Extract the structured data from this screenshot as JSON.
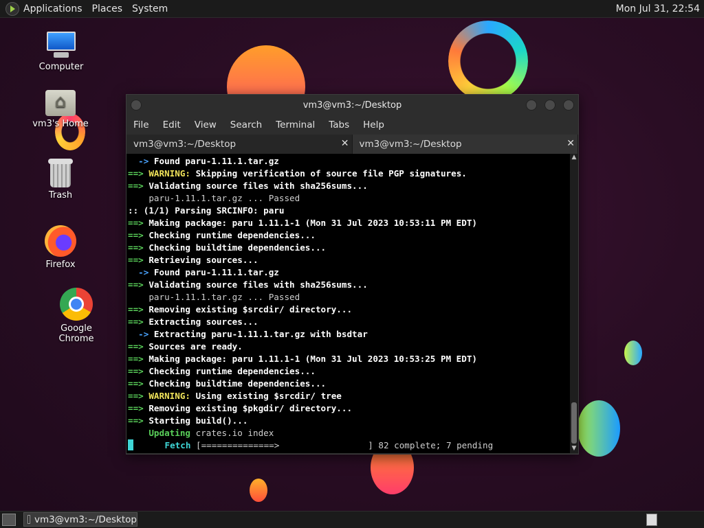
{
  "top_panel": {
    "menus": [
      "Applications",
      "Places",
      "System"
    ],
    "clock": "Mon Jul 31, 22:54"
  },
  "desktop_icons": [
    {
      "label": "Computer"
    },
    {
      "label": "vm3's Home"
    },
    {
      "label": "Trash"
    },
    {
      "label": "Firefox"
    },
    {
      "label": "Google Chrome"
    }
  ],
  "window": {
    "title": "vm3@vm3:~/Desktop",
    "menu": [
      "File",
      "Edit",
      "View",
      "Search",
      "Terminal",
      "Tabs",
      "Help"
    ],
    "tabs": [
      {
        "label": "vm3@vm3:~/Desktop",
        "close": "✕"
      },
      {
        "label": "vm3@vm3:~/Desktop",
        "close": "✕"
      }
    ]
  },
  "terminal": {
    "lines": [
      [
        {
          "c": "bl",
          "t": "  -> "
        },
        {
          "c": "w",
          "t": "Found paru-1.11.1.tar.gz"
        }
      ],
      [
        {
          "c": "g",
          "t": "==> "
        },
        {
          "c": "y",
          "t": "WARNING: "
        },
        {
          "c": "w",
          "t": "Skipping verification of source file PGP signatures."
        }
      ],
      [
        {
          "c": "g",
          "t": "==> "
        },
        {
          "c": "w",
          "t": "Validating source files with sha256sums..."
        }
      ],
      [
        {
          "c": "d",
          "t": "    paru-1.11.1.tar.gz ... Passed"
        }
      ],
      [
        {
          "c": "w",
          "t": ":: (1/1) Parsing SRCINFO: paru"
        }
      ],
      [
        {
          "c": "g",
          "t": "==> "
        },
        {
          "c": "w",
          "t": "Making package: paru 1.11.1-1 (Mon 31 Jul 2023 10:53:11 PM EDT)"
        }
      ],
      [
        {
          "c": "g",
          "t": "==> "
        },
        {
          "c": "w",
          "t": "Checking runtime dependencies..."
        }
      ],
      [
        {
          "c": "g",
          "t": "==> "
        },
        {
          "c": "w",
          "t": "Checking buildtime dependencies..."
        }
      ],
      [
        {
          "c": "g",
          "t": "==> "
        },
        {
          "c": "w",
          "t": "Retrieving sources..."
        }
      ],
      [
        {
          "c": "bl",
          "t": "  -> "
        },
        {
          "c": "w",
          "t": "Found paru-1.11.1.tar.gz"
        }
      ],
      [
        {
          "c": "g",
          "t": "==> "
        },
        {
          "c": "w",
          "t": "Validating source files with sha256sums..."
        }
      ],
      [
        {
          "c": "d",
          "t": "    paru-1.11.1.tar.gz ... Passed"
        }
      ],
      [
        {
          "c": "g",
          "t": "==> "
        },
        {
          "c": "w",
          "t": "Removing existing $srcdir/ directory..."
        }
      ],
      [
        {
          "c": "g",
          "t": "==> "
        },
        {
          "c": "w",
          "t": "Extracting sources..."
        }
      ],
      [
        {
          "c": "bl",
          "t": "  -> "
        },
        {
          "c": "w",
          "t": "Extracting paru-1.11.1.tar.gz with bsdtar"
        }
      ],
      [
        {
          "c": "g",
          "t": "==> "
        },
        {
          "c": "w",
          "t": "Sources are ready."
        }
      ],
      [
        {
          "c": "g",
          "t": "==> "
        },
        {
          "c": "w",
          "t": "Making package: paru 1.11.1-1 (Mon 31 Jul 2023 10:53:25 PM EDT)"
        }
      ],
      [
        {
          "c": "g",
          "t": "==> "
        },
        {
          "c": "w",
          "t": "Checking runtime dependencies..."
        }
      ],
      [
        {
          "c": "g",
          "t": "==> "
        },
        {
          "c": "w",
          "t": "Checking buildtime dependencies..."
        }
      ],
      [
        {
          "c": "g",
          "t": "==> "
        },
        {
          "c": "y",
          "t": "WARNING: "
        },
        {
          "c": "w",
          "t": "Using existing $srcdir/ tree"
        }
      ],
      [
        {
          "c": "g",
          "t": "==> "
        },
        {
          "c": "w",
          "t": "Removing existing $pkgdir/ directory..."
        }
      ],
      [
        {
          "c": "g",
          "t": "==> "
        },
        {
          "c": "w",
          "t": "Starting build()..."
        }
      ],
      [
        {
          "c": "g",
          "t": "    Updating "
        },
        {
          "c": "d",
          "t": "crates.io index"
        }
      ],
      [
        {
          "c": "cursor",
          "t": ""
        },
        {
          "c": "c",
          "t": "      Fetch "
        },
        {
          "c": "d",
          "t": "[==============>                 ] 82 complete; 7 pending"
        }
      ]
    ]
  },
  "bottom_panel": {
    "task_label": "vm3@vm3:~/Desktop"
  }
}
